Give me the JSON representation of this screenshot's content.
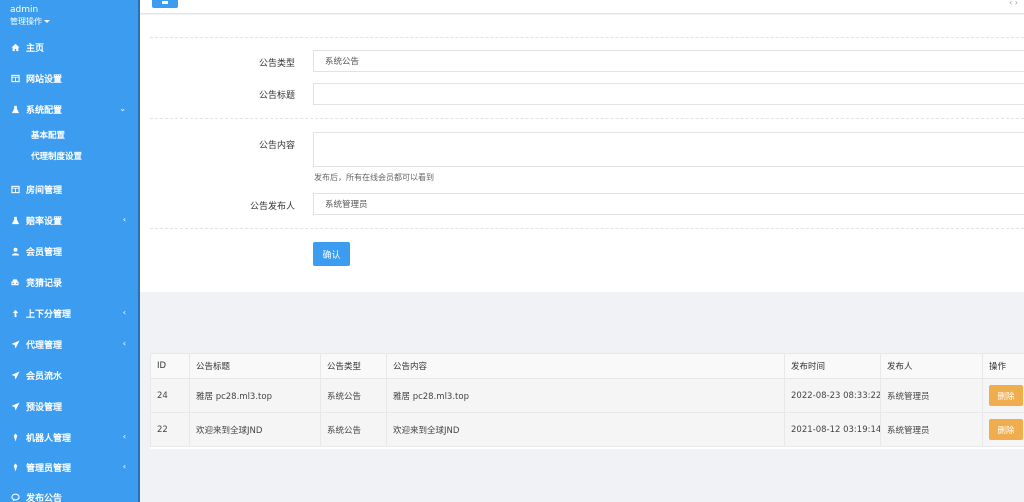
{
  "user": {
    "name": "admin",
    "role": "管理操作"
  },
  "sidebar": {
    "items": [
      {
        "label": "主页",
        "icon": "home-icon"
      },
      {
        "label": "网站设置",
        "icon": "window-icon"
      },
      {
        "label": "系统配置",
        "icon": "flask-icon"
      },
      {
        "label": "房间管理",
        "icon": "window-icon"
      },
      {
        "label": "赔率设置",
        "icon": "flask-icon"
      },
      {
        "label": "会员管理",
        "icon": "user-icon"
      },
      {
        "label": "竞猜记录",
        "icon": "car-icon"
      },
      {
        "label": "上下分管理",
        "icon": "arrow-up-icon"
      },
      {
        "label": "代理管理",
        "icon": "send-icon"
      },
      {
        "label": "会员流水",
        "icon": "send-icon"
      },
      {
        "label": "预设管理",
        "icon": "send-icon"
      },
      {
        "label": "机器人管理",
        "icon": "diamond-icon"
      },
      {
        "label": "管理员管理",
        "icon": "diamond-icon"
      },
      {
        "label": "发布公告",
        "icon": "chat-icon"
      }
    ],
    "subitems": [
      "基本配置",
      "代理制度设置"
    ]
  },
  "form": {
    "type_label": "公告类型",
    "type_value": "系统公告",
    "title_label": "公告标题",
    "title_value": "",
    "content_label": "公告内容",
    "content_value": "",
    "content_hint": "发布后，所有在线会员都可以看到",
    "publisher_label": "公告发布人",
    "publisher_value": "系统管理员",
    "confirm_label": "确认"
  },
  "table": {
    "headers": [
      "ID",
      "公告标题",
      "公告类型",
      "公告内容",
      "发布时间",
      "发布人",
      "操作"
    ],
    "rows": [
      {
        "id": "24",
        "title": "雅居 pc28.ml3.top",
        "type": "系统公告",
        "content": "雅居 pc28.ml3.top",
        "time": "2022-08-23 08:33:22",
        "publisher": "系统管理员",
        "action": "删除"
      },
      {
        "id": "22",
        "title": "欢迎来到全球JND",
        "type": "系统公告",
        "content": "欢迎来到全球JND",
        "time": "2021-08-12 03:19:14",
        "publisher": "系统管理员",
        "action": "删除"
      }
    ]
  }
}
